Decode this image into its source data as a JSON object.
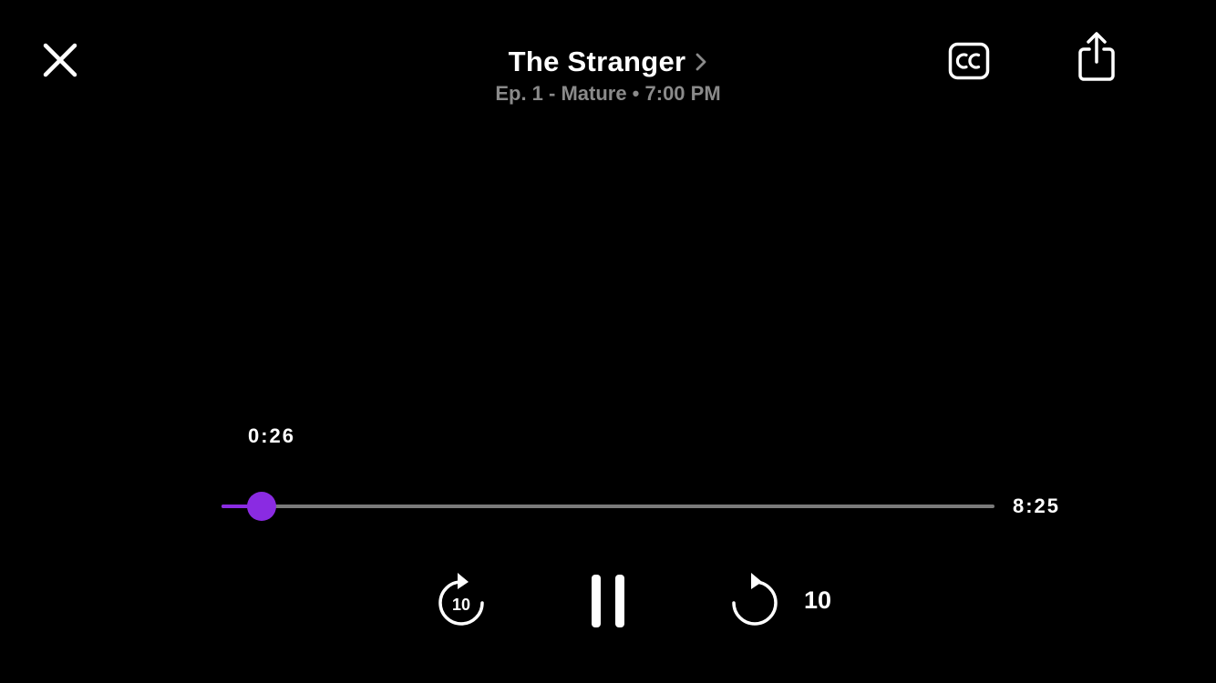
{
  "header": {
    "title": "The Stranger",
    "subtitle": "Ep. 1 - Mature • 7:00 PM",
    "close_icon": "close-icon",
    "title_chevron_icon": "chevron-right-icon",
    "cc_icon": "closed-captions-icon",
    "share_icon": "share-icon"
  },
  "player": {
    "current_time": "0:26",
    "duration": "8:25",
    "progress_fraction": 0.0515,
    "accent_color": "#8a2be2",
    "track_color": "#7a7a7a"
  },
  "controls": {
    "rewind_label": "10",
    "rewind_icon": "rewind-10-icon",
    "pause_icon": "pause-icon",
    "forward_icon": "forward-icon",
    "forward_label": "10"
  }
}
